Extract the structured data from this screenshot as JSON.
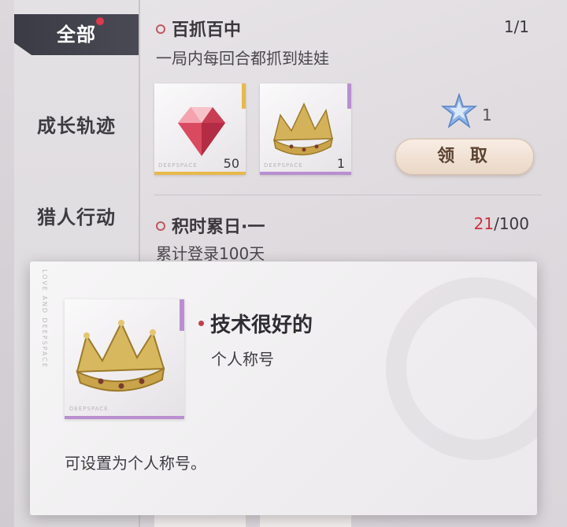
{
  "sidebar": {
    "tabs": [
      {
        "label": "全部",
        "active": true,
        "has_badge": true
      },
      {
        "label": "成长轨迹",
        "active": false
      },
      {
        "label": "猎人行动",
        "active": false
      }
    ]
  },
  "tasks": [
    {
      "title": "百抓百中",
      "description": "一局内每回合都抓到娃娃",
      "progress": "1/1",
      "rewards": [
        {
          "icon": "gem-icon",
          "qty": "50",
          "brand": "DEEPSPACE",
          "rarity_color": "#e8b84a"
        },
        {
          "icon": "crown-icon",
          "qty": "1",
          "brand": "DEEPSPACE",
          "rarity_color": "#b98fd0"
        }
      ],
      "star_reward": "1",
      "claim_label": "领 取"
    },
    {
      "title": "积时累日·一",
      "description": "累计登录100天",
      "progress_current": "21",
      "progress_total": "/100"
    }
  ],
  "popup": {
    "side_text": "LOVE AND DEEPSPACE",
    "card_brand": "DEEPSPACE",
    "item_icon": "crown-icon",
    "title": "技术很好的",
    "type": "个人称号",
    "description": "可设置为个人称号。"
  }
}
